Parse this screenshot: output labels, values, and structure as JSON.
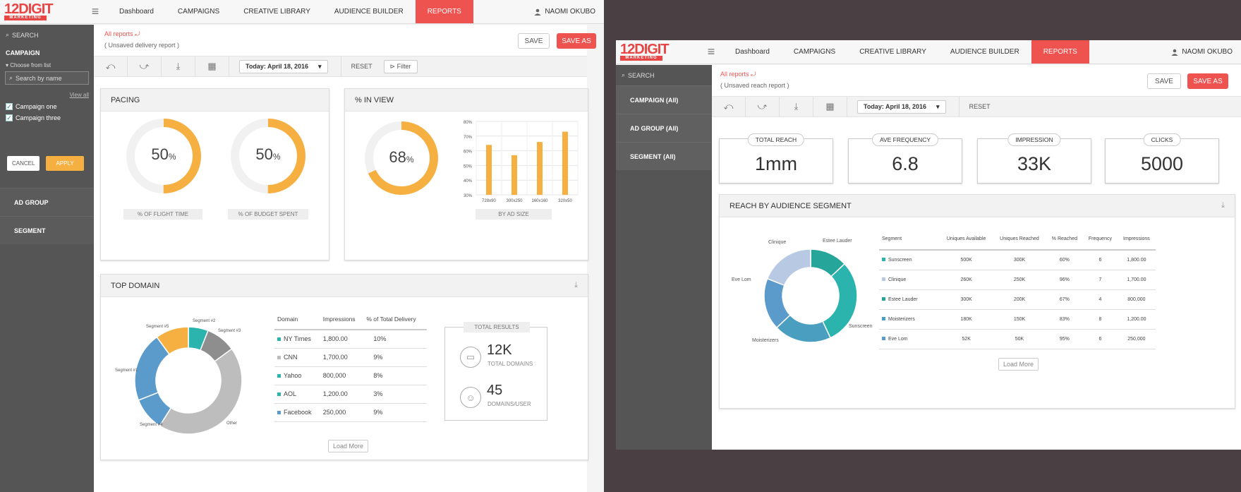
{
  "colors": {
    "accent": "#ef5350",
    "orange": "#f6b042",
    "teal": "#2bb3ad",
    "blue": "#5a9bcb",
    "gray": "#bdbdbd",
    "darkgray": "#8e8e8e",
    "lightblue": "#b8c9e4",
    "tealdark": "#26a69a"
  },
  "brand": {
    "logo": "12DIGIT",
    "logo_sub": "MARKETING"
  },
  "nav": {
    "items": [
      "Dashboard",
      "CAMPAIGNS",
      "CREATIVE LIBRARY",
      "AUDIENCE BUILDER",
      "REPORTS"
    ],
    "active": "REPORTS",
    "user": "NAOMI OKUBO"
  },
  "screen1": {
    "sidebar": {
      "search": "SEARCH",
      "campaign_title": "CAMPAIGN",
      "choose": "Choose from list",
      "search_placeholder": "Search by name",
      "view_all": "View all",
      "checks": [
        "Campaign one",
        "Campaign three"
      ],
      "cancel": "CANCEL",
      "apply": "APPLY",
      "sections": [
        "AD GROUP",
        "SEGMENT"
      ]
    },
    "header": {
      "all_reports": "All reports",
      "unsaved": "( Unsaved delivery report )",
      "save": "SAVE",
      "save_as": "SAVE AS"
    },
    "toolbar": {
      "date": "Today: April 18, 2016",
      "reset": "RESET",
      "filter": "Filter"
    },
    "pacing": {
      "title": "PACING",
      "flight_value": "50",
      "flight_pct": 50,
      "flight_label": "% OF FLIGHT TIME",
      "budget_value": "50",
      "budget_pct": 50,
      "budget_label": "% OF BUDGET SPENT",
      "unit": "%"
    },
    "inview": {
      "title": "% IN VIEW",
      "value": "68",
      "pct": 68,
      "unit": "%",
      "bar_label": "BY AD SIZE"
    },
    "top_domain": {
      "title": "TOP DOMAIN",
      "segment_labels": [
        "Segment #2",
        "Segment #3",
        "Segment #5",
        "Segment #1",
        "Segment #4",
        "Other"
      ],
      "table": {
        "headers": [
          "Domain",
          "Impressions",
          "% of Total Delivery"
        ],
        "rows": [
          {
            "domain": "NY Times",
            "impressions": "1,800.00",
            "pct": "10%",
            "color": "#2bb3ad"
          },
          {
            "domain": "CNN",
            "impressions": "1,700.00",
            "pct": "9%",
            "color": "#bdbdbd"
          },
          {
            "domain": "Yahoo",
            "impressions": "800,000",
            "pct": "8%",
            "color": "#2bb3ad"
          },
          {
            "domain": "AOL",
            "impressions": "1,200.00",
            "pct": "3%",
            "color": "#2bb3ad"
          },
          {
            "domain": "Facebook",
            "impressions": "250,000",
            "pct": "9%",
            "color": "#5a9bcb"
          }
        ]
      },
      "load_more": "Load More",
      "total_results": {
        "label": "TOTAL RESULTS",
        "domains_value": "12K",
        "domains_label": "TOTAL DOMAINS",
        "users_value": "45",
        "users_label": "DOMAINS/USER"
      }
    }
  },
  "screen2": {
    "sidebar": {
      "search": "SEARCH",
      "sections": [
        "CAMPAIGN (All)",
        "AD GROUP (All)",
        "SEGMENT (All)"
      ]
    },
    "header": {
      "all_reports": "All reports",
      "unsaved": "( Unsaved reach report )",
      "save": "SAVE",
      "save_as": "SAVE AS"
    },
    "toolbar": {
      "date": "Today: April 18, 2016",
      "reset": "RESET"
    },
    "kpis": [
      {
        "label": "TOTAL REACH",
        "value": "1mm"
      },
      {
        "label": "AVE FREQUENCY",
        "value": "6.8"
      },
      {
        "label": "IMPRESSION",
        "value": "33K"
      },
      {
        "label": "CLICKS",
        "value": "5000"
      }
    ],
    "reach": {
      "title": "REACH BY AUDIENCE SEGMENT",
      "segment_labels": [
        "Clinique",
        "Estee Lauder",
        "Eve Lom",
        "Sunscreen",
        "Moisterizers"
      ],
      "table": {
        "headers": [
          "Segment",
          "Uniques Available",
          "Uniques Reached",
          "% Reached",
          "Frequency",
          "Impressions"
        ],
        "rows": [
          {
            "segment": "Sunscreen",
            "available": "500K",
            "reached": "300K",
            "pct": "60%",
            "freq": "6",
            "imp": "1,800.00",
            "color": "#2bb3ad"
          },
          {
            "segment": "Clinique",
            "available": "260K",
            "reached": "250K",
            "pct": "96%",
            "freq": "7",
            "imp": "1,700.00",
            "color": "#b8c9e4"
          },
          {
            "segment": "Estee Lauder",
            "available": "300K",
            "reached": "200K",
            "pct": "67%",
            "freq": "4",
            "imp": "800,000",
            "color": "#26a69a"
          },
          {
            "segment": "Moisterizers",
            "available": "180K",
            "reached": "150K",
            "pct": "83%",
            "freq": "8",
            "imp": "1,200.00",
            "color": "#4a9fc0"
          },
          {
            "segment": "Eve Lom",
            "available": "52K",
            "reached": "50K",
            "pct": "95%",
            "freq": "6",
            "imp": "250,000",
            "color": "#5a9bcb"
          }
        ]
      },
      "load_more": "Load More"
    }
  },
  "chart_data": [
    {
      "type": "bar",
      "title": "% IN VIEW",
      "xlabel": "BY AD SIZE",
      "categories": [
        "728x90",
        "300x250",
        "160x160",
        "320x50"
      ],
      "values": [
        64,
        57,
        66,
        73
      ],
      "ylim": [
        30,
        80
      ],
      "yticks": [
        "30%",
        "40%",
        "50%",
        "60%",
        "70%",
        "80%"
      ],
      "grid": true
    },
    {
      "type": "pie",
      "title": "TOP DOMAIN",
      "labels": [
        "Segment #2",
        "Segment #3",
        "Other",
        "Segment #4",
        "Segment #1",
        "Segment #5"
      ],
      "values": [
        6,
        9,
        44,
        10,
        21,
        10
      ]
    },
    {
      "type": "pie",
      "title": "REACH BY AUDIENCE SEGMENT",
      "labels": [
        "Estee Lauder",
        "Sunscreen",
        "Moisterizers",
        "Eve Lom",
        "Clinique"
      ],
      "values": [
        13,
        30,
        20,
        18,
        19
      ]
    }
  ]
}
